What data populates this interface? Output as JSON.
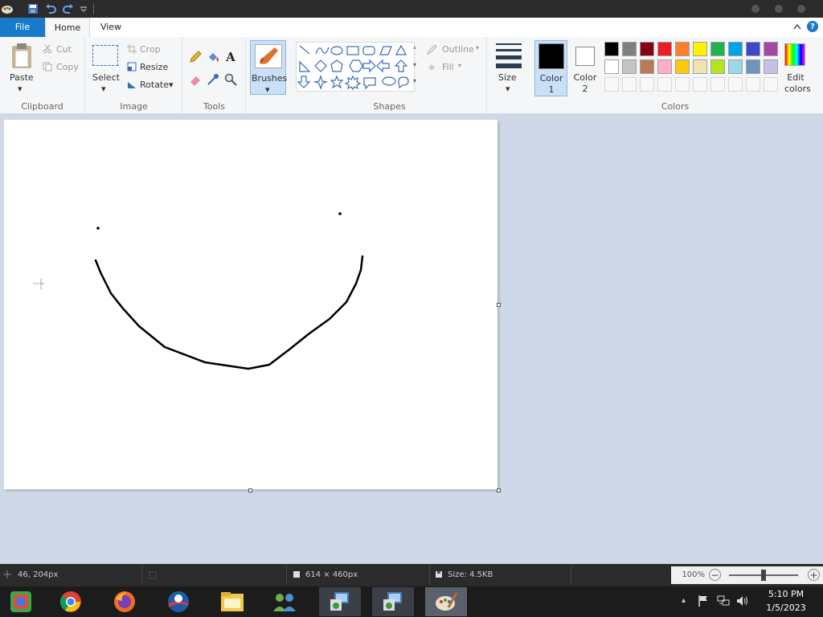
{
  "window": {
    "title": ""
  },
  "tabs": {
    "file": "File",
    "home": "Home",
    "view": "View"
  },
  "clipboard": {
    "paste": "Paste",
    "cut": "Cut",
    "copy": "Copy",
    "group": "Clipboard"
  },
  "image": {
    "select": "Select",
    "crop": "Crop",
    "resize": "Resize",
    "rotate": "Rotate",
    "group": "Image"
  },
  "tools": {
    "group": "Tools"
  },
  "brushes": {
    "label": "Brushes"
  },
  "shapes": {
    "outline": "Outline",
    "fill": "Fill",
    "group": "Shapes"
  },
  "size": {
    "label": "Size"
  },
  "color1": {
    "label": "Color 1",
    "value": "#000000"
  },
  "color2": {
    "label": "Color 2",
    "value": "#ffffff"
  },
  "colors": {
    "group": "Colors",
    "edit": "Edit colors",
    "row1": [
      "#000000",
      "#7f7f7f",
      "#880015",
      "#ed1c24",
      "#ff7f27",
      "#fff200",
      "#22b14c",
      "#00a2e8",
      "#3f48cc",
      "#a349a4"
    ],
    "row2": [
      "#ffffff",
      "#c3c3c3",
      "#b97a57",
      "#ffaec9",
      "#ffc90e",
      "#efe4b0",
      "#b5e61d",
      "#99d9ea",
      "#7092be",
      "#c8bfe7"
    ]
  },
  "status": {
    "cursor": "46, 204px",
    "dimensions": "614 × 460px",
    "size": "Size: 4.5KB",
    "zoom": "100%",
    "zoom_fraction": 0.5
  },
  "clock": {
    "time": "5:10 PM",
    "date": "1/5/2023"
  },
  "taskbar": {
    "apps": [
      "start-icon",
      "chrome-icon",
      "firefox-icon",
      "obama-icon",
      "file-explorer-icon",
      "people-icon",
      "remote-desktop-icon",
      "remote-desktop-icon-2",
      "paint-icon"
    ]
  }
}
